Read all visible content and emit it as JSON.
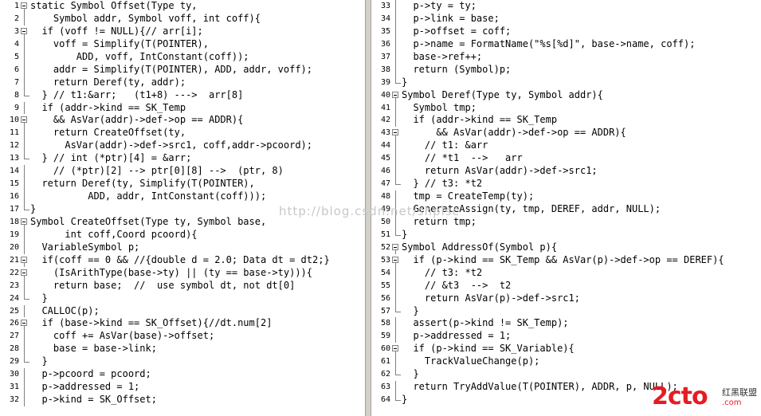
{
  "watermark": "http://blog.csdn.net/shpisc",
  "logo": {
    "main": "2cto",
    "sub_cn": "红黑联盟",
    "sub_url": ".com"
  },
  "left_pane": [
    {
      "n": "1",
      "t": "static Symbol Offset(Type ty,",
      "fold": "box"
    },
    {
      "n": "2",
      "t": "    Symbol addr, Symbol voff, int coff){",
      "fold": "bar"
    },
    {
      "n": "3",
      "t": "  if (voff != NULL){// arr[i];",
      "fold": "box"
    },
    {
      "n": "4",
      "t": "    voff = Simplify(T(POINTER),",
      "fold": "bar"
    },
    {
      "n": "5",
      "t": "        ADD, voff, IntConstant(coff));",
      "fold": "bar"
    },
    {
      "n": "6",
      "t": "    addr = Simplify(T(POINTER), ADD, addr, voff);",
      "fold": "bar"
    },
    {
      "n": "7",
      "t": "    return Deref(ty, addr);",
      "fold": "bar"
    },
    {
      "n": "8",
      "t": "  } // t1:&arr;   (t1+8) --->  arr[8]",
      "fold": "end"
    },
    {
      "n": "9",
      "t": "  if (addr->kind == SK_Temp",
      "fold": "bar"
    },
    {
      "n": "10",
      "t": "    && AsVar(addr)->def->op == ADDR){",
      "fold": "box"
    },
    {
      "n": "11",
      "t": "    return CreateOffset(ty,",
      "fold": "bar"
    },
    {
      "n": "12",
      "t": "      AsVar(addr)->def->src1, coff,addr->pcoord);",
      "fold": "bar"
    },
    {
      "n": "13",
      "t": "  } // int (*ptr)[4] = &arr;",
      "fold": "end"
    },
    {
      "n": "14",
      "t": "    // (*ptr)[2] --> ptr[0][8] -->  (ptr, 8)",
      "fold": "bar"
    },
    {
      "n": "15",
      "t": "  return Deref(ty, Simplify(T(POINTER),",
      "fold": "bar"
    },
    {
      "n": "16",
      "t": "          ADD, addr, IntConstant(coff)));",
      "fold": "bar"
    },
    {
      "n": "17",
      "t": "}",
      "fold": "end"
    },
    {
      "n": "18",
      "t": "Symbol CreateOffset(Type ty, Symbol base,",
      "fold": "box"
    },
    {
      "n": "19",
      "t": "      int coff,Coord pcoord){",
      "fold": "bar"
    },
    {
      "n": "20",
      "t": "  VariableSymbol p;",
      "fold": "bar"
    },
    {
      "n": "21",
      "t": "  if(coff == 0 && //{double d = 2.0; Data dt = dt2;}",
      "fold": "box"
    },
    {
      "n": "22",
      "t": "    (IsArithType(base->ty) || (ty == base->ty))){",
      "fold": "box"
    },
    {
      "n": "23",
      "t": "    return base;  //  use symbol dt, not dt[0]",
      "fold": "bar"
    },
    {
      "n": "24",
      "t": "  }",
      "fold": "end"
    },
    {
      "n": "25",
      "t": "  CALLOC(p);",
      "fold": "bar"
    },
    {
      "n": "26",
      "t": "  if (base->kind == SK_Offset){//dt.num[2]",
      "fold": "box"
    },
    {
      "n": "27",
      "t": "    coff += AsVar(base)->offset;",
      "fold": "bar"
    },
    {
      "n": "28",
      "t": "    base = base->link;",
      "fold": "bar"
    },
    {
      "n": "29",
      "t": "  }",
      "fold": "end"
    },
    {
      "n": "30",
      "t": "  p->pcoord = pcoord;",
      "fold": "bar"
    },
    {
      "n": "31",
      "t": "  p->addressed = 1;",
      "fold": "bar"
    },
    {
      "n": "32",
      "t": "  p->kind = SK_Offset;",
      "fold": "bar"
    }
  ],
  "right_pane": [
    {
      "n": "33",
      "t": "  p->ty = ty;",
      "fold": "bar"
    },
    {
      "n": "34",
      "t": "  p->link = base;",
      "fold": "bar"
    },
    {
      "n": "35",
      "t": "  p->offset = coff;",
      "fold": "bar"
    },
    {
      "n": "36",
      "t": "  p->name = FormatName(\"%s[%d]\", base->name, coff);",
      "fold": "bar"
    },
    {
      "n": "37",
      "t": "  base->ref++;",
      "fold": "bar"
    },
    {
      "n": "38",
      "t": "  return (Symbol)p;",
      "fold": "bar"
    },
    {
      "n": "39",
      "t": "}",
      "fold": "end"
    },
    {
      "n": "40",
      "t": "Symbol Deref(Type ty, Symbol addr){",
      "fold": "box"
    },
    {
      "n": "41",
      "t": "  Symbol tmp;",
      "fold": "bar"
    },
    {
      "n": "42",
      "t": "  if (addr->kind == SK_Temp",
      "fold": "bar"
    },
    {
      "n": "43",
      "t": "      && AsVar(addr)->def->op == ADDR){",
      "fold": "box"
    },
    {
      "n": "44",
      "t": "    // t1: &arr",
      "fold": "bar"
    },
    {
      "n": "45",
      "t": "    // *t1  -->   arr",
      "fold": "bar"
    },
    {
      "n": "46",
      "t": "    return AsVar(addr)->def->src1;",
      "fold": "bar"
    },
    {
      "n": "47",
      "t": "  } // t3: *t2",
      "fold": "end"
    },
    {
      "n": "48",
      "t": "  tmp = CreateTemp(ty);",
      "fold": "bar"
    },
    {
      "n": "49",
      "t": "  GenerateAssign(ty, tmp, DEREF, addr, NULL);",
      "fold": "bar"
    },
    {
      "n": "50",
      "t": "  return tmp;",
      "fold": "bar"
    },
    {
      "n": "51",
      "t": "}",
      "fold": "end"
    },
    {
      "n": "52",
      "t": "Symbol AddressOf(Symbol p){",
      "fold": "box"
    },
    {
      "n": "53",
      "t": "  if (p->kind == SK_Temp && AsVar(p)->def->op == DEREF){",
      "fold": "box"
    },
    {
      "n": "54",
      "t": "    // t3: *t2",
      "fold": "bar"
    },
    {
      "n": "55",
      "t": "    // &t3  -->  t2",
      "fold": "bar"
    },
    {
      "n": "56",
      "t": "    return AsVar(p)->def->src1;",
      "fold": "bar"
    },
    {
      "n": "57",
      "t": "  }",
      "fold": "end"
    },
    {
      "n": "58",
      "t": "  assert(p->kind != SK_Temp);",
      "fold": "bar"
    },
    {
      "n": "59",
      "t": "  p->addressed = 1;",
      "fold": "bar"
    },
    {
      "n": "60",
      "t": "  if (p->kind == SK_Variable){",
      "fold": "box"
    },
    {
      "n": "61",
      "t": "    TrackValueChange(p);",
      "fold": "bar"
    },
    {
      "n": "62",
      "t": "  }",
      "fold": "end"
    },
    {
      "n": "63",
      "t": "  return TryAddValue(T(POINTER), ADDR, p, NULL);",
      "fold": "bar"
    },
    {
      "n": "64",
      "t": "}",
      "fold": "end"
    }
  ]
}
